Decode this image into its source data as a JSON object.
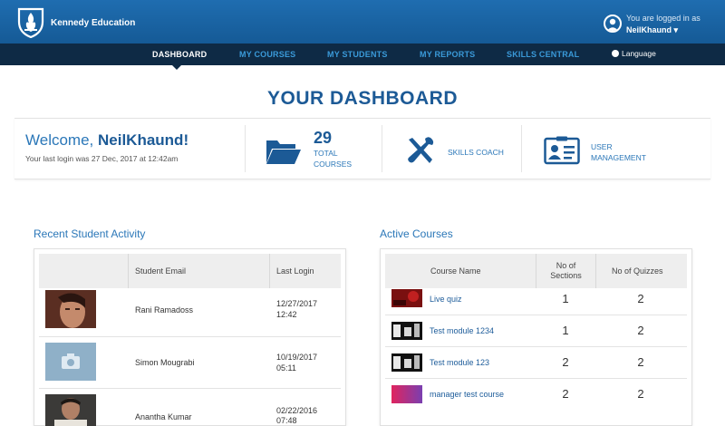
{
  "header": {
    "brand": "Kennedy Education",
    "logged_in_text": "You are logged in as",
    "user_name": "NeilKhaund ▾"
  },
  "nav": {
    "items": [
      "DASHBOARD",
      "MY COURSES",
      "MY STUDENTS",
      "MY REPORTS",
      "SKILLS CENTRAL"
    ],
    "active": "DASHBOARD",
    "language": "Language"
  },
  "page_title": "YOUR DASHBOARD",
  "welcome": {
    "greeting": "Welcome, ",
    "name": "NeilKhaund!",
    "last_login": "Your last login was 27 Dec, 2017 at 12:42am"
  },
  "stats": {
    "total_courses_count": "29",
    "total_label_1": "TOTAL",
    "total_label_2": "COURSES",
    "skills_coach": "SKILLS COACH",
    "user_label_1": "USER",
    "user_label_2": "MANAGEMENT"
  },
  "recent_activity": {
    "heading": "Recent Student Activity",
    "columns": [
      "",
      "Student Email",
      "Last Login"
    ],
    "rows": [
      {
        "name": "Rani Ramadoss",
        "date": "12/27/2017",
        "time": "12:42"
      },
      {
        "name": "Simon Mougrabi",
        "date": "10/19/2017",
        "time": "05:11"
      },
      {
        "name": "Anantha Kumar",
        "date": "02/22/2016",
        "time": "07:48"
      }
    ]
  },
  "active_courses": {
    "heading": "Active Courses",
    "columns": [
      "Course Name",
      "No of",
      "Sections",
      "No of Quizzes"
    ],
    "rows": [
      {
        "name": "Live quiz",
        "sections": "1",
        "quizzes": "2"
      },
      {
        "name": "Test module 1234",
        "sections": "1",
        "quizzes": "2"
      },
      {
        "name": "Test module 123",
        "sections": "2",
        "quizzes": "2"
      },
      {
        "name": "manager test course",
        "sections": "2",
        "quizzes": "2"
      }
    ]
  },
  "colors": {
    "header_blue": "#1a63a5",
    "nav_dark": "#0e2a45",
    "accent_blue": "#1c5a96",
    "link_blue": "#2b77b8"
  }
}
